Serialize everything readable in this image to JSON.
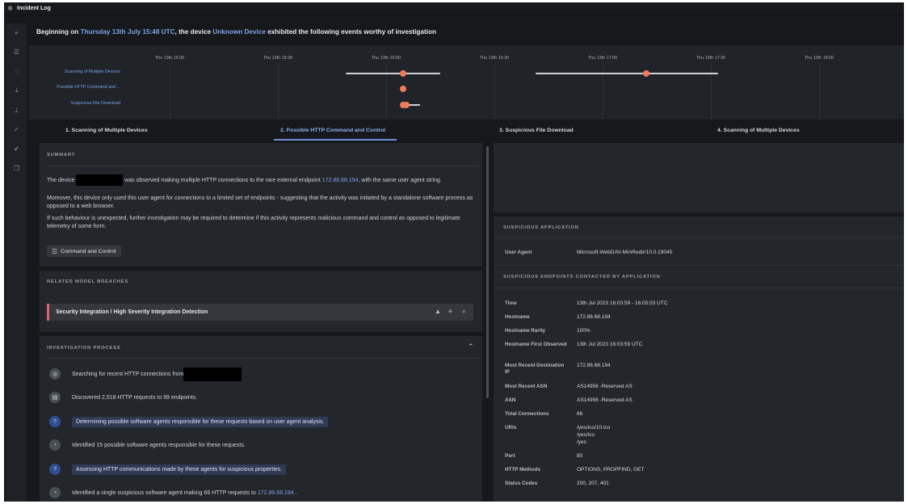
{
  "window": {
    "title": "Incident Log",
    "icon": "incident-icon"
  },
  "sidebar": {
    "icons": [
      "chevrons-down-icon",
      "list-icon",
      "chat-icon",
      "download-icon",
      "pin-icon",
      "check-icon",
      "double-check-icon",
      "copy-icon"
    ]
  },
  "headline": {
    "prefix": "Beginning on ",
    "date": "Thursday 13th July 15:48 UTC",
    "middle": ", the device ",
    "device": "Unknown Device",
    "suffix": " exhibited the following events worthy of investigation"
  },
  "timeline": {
    "ticks": [
      "Thu 13th 15:00",
      "Thu 13th 15:30",
      "Thu 13th 16:00",
      "Thu 13th 16:30",
      "Thu 13th 17:00",
      "Thu 13th 17:30",
      "Thu 13th 18:00"
    ],
    "rows": [
      "Scanning of Multiple Devices",
      "Possible HTTP Command and ...",
      "Suspicious File Download"
    ]
  },
  "tabs": [
    {
      "label": "1. Scanning of Multiple Devices",
      "active": false
    },
    {
      "label": "2. Possible HTTP Command and Control",
      "active": true
    },
    {
      "label": "3. Suspicious File Download",
      "active": false
    },
    {
      "label": "4. Scanning of Multiple Devices",
      "active": false
    }
  ],
  "summary": {
    "heading": "SUMMARY",
    "p1_a": "The device ",
    "p1_b": " was observed making multiple HTTP connections to the rare external endpoint ",
    "p1_ip": "172.86.68.194",
    "p1_c": ", with the same user agent string.",
    "p2": "Moreover, this device only used this user agent for connections to a limited set of endpoints - suggesting that the activity was initiated by a standalone software process as opposed to a web browser.",
    "p3": "If such behaviour is unexpected, further investigation may be required to determine if this activity represents malicious command and control as opposed to legitimate telemetry of some form.",
    "chip": "Command and Control"
  },
  "breaches": {
    "heading": "RELATED MODEL BREACHES",
    "items": [
      {
        "label": "Security Integration / High Severity Integration Detection"
      }
    ]
  },
  "investigation": {
    "heading": "INVESTIGATION PROCESS",
    "steps": [
      {
        "text": "Searching for recent HTTP connections from ",
        "icon": "radar-icon"
      },
      {
        "text": "Discovered 2,518 HTTP requests to 99 endpoints.",
        "icon": "chart-icon"
      },
      {
        "text": "Determining possible software agents responsible for these requests based on user agent analysis.",
        "icon": "question-icon"
      },
      {
        "text": "Identified 15 possible software agents responsible for these requests.",
        "icon": "pie-icon"
      },
      {
        "text": "Assessing HTTP communications made by these agents for suspicious properties.",
        "icon": "question-icon"
      },
      {
        "text": "Identified a single suspicious software agent making 66 HTTP requests to ",
        "ip": "172.86.68.194",
        "end": " .",
        "icon": "pie-icon"
      }
    ]
  },
  "application": {
    "heading": "SUSPICIOUS APPLICATION",
    "user_agent_key": "User Agent",
    "user_agent_val": "Microsoft-WebDAV-MiniRedir/10.0.19045"
  },
  "endpoints": {
    "heading": "SUSPICIOUS ENDPOINTS CONTACTED BY APPLICATION",
    "rows": [
      {
        "key": "Time",
        "val": "13th Jul 2023 16:03:59 - 16:05:03 UTC"
      },
      {
        "key": "Hostname",
        "val": "172.86.68.194"
      },
      {
        "key": "Hostname Rarity",
        "val": "100%"
      },
      {
        "key": "Hostname First Observed",
        "val": "13th Jul 2023 16:03:59 UTC"
      },
      {
        "key": "Most Recent Destination IP",
        "val": "172.86.68.194"
      },
      {
        "key": "Most Recent ASN",
        "val": "AS14956 -Reserved AS"
      },
      {
        "key": "ASN",
        "val": "AS14956 -Reserved AS"
      },
      {
        "key": "Total Connections",
        "val": "66"
      },
      {
        "key": "URIs",
        "val": [
          "/yes/ico/10.ico",
          "/yes/ico",
          "/yes"
        ]
      },
      {
        "key": "Port",
        "val": "80"
      },
      {
        "key": "HTTP Methods",
        "val": "OPTIONS, PROPFIND, GET"
      },
      {
        "key": "Status Codes",
        "val": "200, 207, 401"
      }
    ]
  },
  "colors": {
    "accent": "#7ea1e8",
    "alert": "#e0606c",
    "dot": "#ef7b5d"
  }
}
